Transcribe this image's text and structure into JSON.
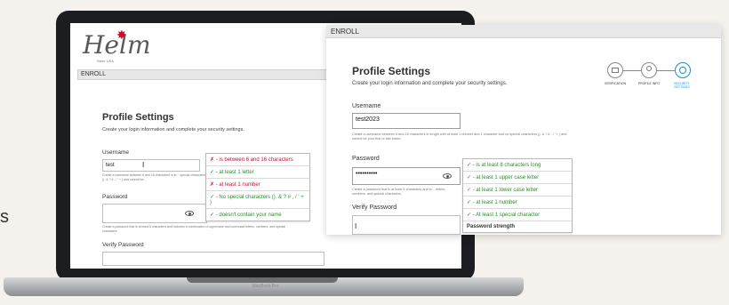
{
  "edge_text": "s",
  "laptop": {
    "brand": "MacBook Pro",
    "logo": "Helm",
    "logo_sub": "Steer USA",
    "enroll": "ENROLL",
    "title": "Profile Settings",
    "subtitle": "Create your login information and complete your security settings.",
    "username_label": "Username",
    "username_value": "test",
    "username_hint": "Create a username between 6 and 16 characters in le... special characters (). & ? # , / ' + ) and cannot be...",
    "password_label": "Password",
    "password_hint": "Create a password that is at least 8 characters and includes a combination of uppercase and lowercase letters, numbers, and special characters.",
    "verify_label": "Verify Password",
    "username_rules": [
      {
        "text": "✗ - is between 6 and 16 characters",
        "status": "bad"
      },
      {
        "text": "✓ - at least 1 letter",
        "status": "good"
      },
      {
        "text": "✗ - at least 1 number",
        "status": "bad"
      },
      {
        "text": "✓ - No special characters (). & ? # , / ' + )",
        "status": "good"
      },
      {
        "text": "✓ - doesn't contain your name",
        "status": "good"
      }
    ]
  },
  "zoom": {
    "enroll": "ENROLL",
    "title": "Profile Settings",
    "subtitle": "Create your login information and complete your security settings.",
    "username_label": "Username",
    "username_value": "test2023",
    "username_hint": "Create a username between 6 and 16 characters in length with at least 1 number and 1 character and no special characters (). & ? # , / ' + ) and cannot be your first or last name.",
    "password_label": "Password",
    "password_value": "••••••••••",
    "password_hint": "Create a password that is at least 8 characters and in... letters, numbers, and special characters.",
    "verify_label": "Verify Password",
    "verify_cursor": "I",
    "strength_label": "Password strength",
    "steps": [
      {
        "label": "VERIFICATION"
      },
      {
        "label": "PROFILE INFO"
      },
      {
        "label": "SECURITY SETTINGS"
      }
    ],
    "password_rules": [
      "✓ - is at least 8 characters long",
      "✓ - at least 1 upper case letter",
      "✓ - at least 1 lower case letter",
      "✓ - at least 1 number",
      "✓ - At least 1 special character"
    ]
  },
  "colors": {
    "error": "#c8102e",
    "success": "#2e8b2e",
    "accent": "#1a8fd1"
  }
}
